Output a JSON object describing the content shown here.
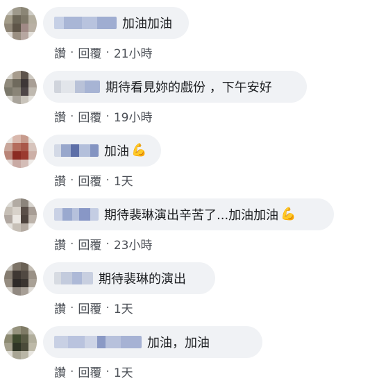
{
  "actions": {
    "like": "讚",
    "reply": "回覆",
    "separator": "·"
  },
  "comments": [
    {
      "text": "加油加油",
      "emoji": "",
      "time": "21小時"
    },
    {
      "text": "期待看見妳的戲份 ，下午安好",
      "emoji": "",
      "time": "19小時"
    },
    {
      "text": "加油",
      "emoji": "💪",
      "time": "1天"
    },
    {
      "text": "期待裴琳演出辛苦了...加油加油",
      "emoji": "💪",
      "time": "23小時"
    },
    {
      "text": "期待裴琳的演出",
      "emoji": "",
      "time": "1天"
    },
    {
      "text": "加油，加油",
      "emoji": "",
      "time": "1天"
    }
  ]
}
